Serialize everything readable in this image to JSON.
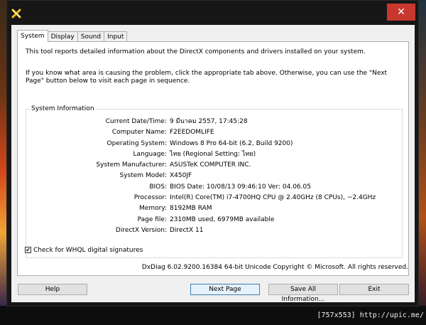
{
  "window": {
    "close_label": "✕",
    "app_icon": "directx-x-icon"
  },
  "tabs": [
    {
      "label": "System",
      "active": true
    },
    {
      "label": "Display",
      "active": false
    },
    {
      "label": "Sound",
      "active": false
    },
    {
      "label": "Input",
      "active": false
    }
  ],
  "intro_text": "This tool reports detailed information about the DirectX components and drivers installed on your system.",
  "hint_text": "If you know what area is causing the problem, click the appropriate tab above.  Otherwise, you can use the \"Next Page\" button below to visit each page in sequence.",
  "system_info": {
    "title": "System Information",
    "rows": [
      {
        "label": "Current Date/Time:",
        "value": "9 มีนาคม 2557, 17:45:28"
      },
      {
        "label": "Computer Name:",
        "value": "F2EEDOMLIFE"
      },
      {
        "label": "Operating System:",
        "value": "Windows 8 Pro 64-bit (6.2, Build 9200)"
      },
      {
        "label": "Language:",
        "value": "ไทย (Regional Setting: ไทย)"
      },
      {
        "label": "System Manufacturer:",
        "value": "ASUSTeK COMPUTER INC."
      },
      {
        "label": "System Model:",
        "value": "X450JF"
      },
      {
        "label": "BIOS:",
        "value": "BIOS Date: 10/08/13 09:46:10 Ver: 04.06.05"
      },
      {
        "label": "Processor:",
        "value": "Intel(R) Core(TM) i7-4700HQ CPU @ 2.40GHz (8 CPUs), ~2.4GHz"
      },
      {
        "label": "Memory:",
        "value": "8192MB RAM"
      },
      {
        "label": "Page file:",
        "value": "2310MB used, 6979MB available"
      },
      {
        "label": "DirectX Version:",
        "value": "DirectX 11"
      }
    ]
  },
  "whql": {
    "label": "Check for WHQL digital signatures",
    "checked": true,
    "check_mark": "✔"
  },
  "footer_text": "DxDiag 6.02.9200.16384 64-bit Unicode  Copyright © Microsoft. All rights reserved.",
  "buttons": {
    "help": "Help",
    "next_page": "Next Page",
    "save_all": "Save All Information...",
    "exit": "Exit"
  },
  "watermark": "[757x553] http://upic.me/"
}
